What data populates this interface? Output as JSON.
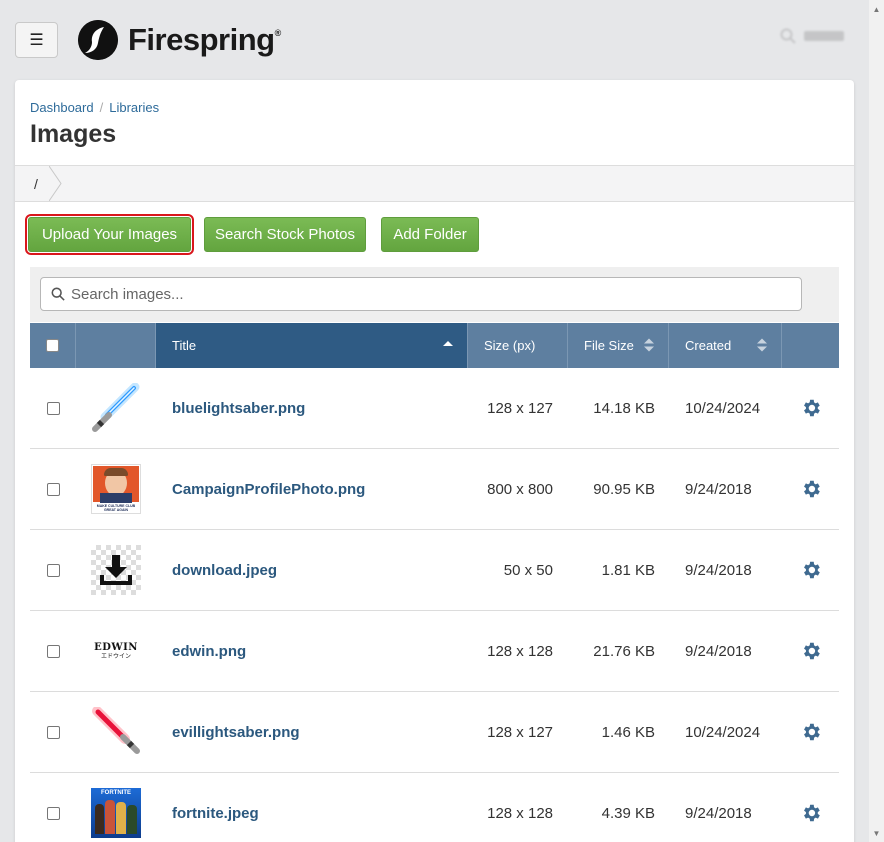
{
  "logo": {
    "name": "Firespring",
    "trademark": "®"
  },
  "breadcrumb": {
    "dashboard": "Dashboard",
    "separator": "/",
    "libraries": "Libraries"
  },
  "page": {
    "title": "Images"
  },
  "pathbar": {
    "root": "/"
  },
  "actions": {
    "upload": "Upload Your Images",
    "stock": "Search Stock Photos",
    "folder": "Add Folder"
  },
  "search": {
    "placeholder": "Search images..."
  },
  "table": {
    "headers": {
      "title": "Title",
      "size": "Size (px)",
      "file_size": "File Size",
      "created": "Created"
    },
    "rows": [
      {
        "title": "bluelightsaber.png",
        "size": "128 x 127",
        "file_size": "14.18 KB",
        "created": "10/24/2024",
        "thumb": "blue-lightsaber"
      },
      {
        "title": "CampaignProfilePhoto.png",
        "size": "800 x 800",
        "file_size": "90.95 KB",
        "created": "9/24/2018",
        "thumb": "campaign-photo"
      },
      {
        "title": "download.jpeg",
        "size": "50 x 50",
        "file_size": "1.81 KB",
        "created": "9/24/2018",
        "thumb": "download-icon"
      },
      {
        "title": "edwin.png",
        "size": "128 x 128",
        "file_size": "21.76 KB",
        "created": "9/24/2018",
        "thumb": "edwin-logo"
      },
      {
        "title": "evillightsaber.png",
        "size": "128 x 127",
        "file_size": "1.46 KB",
        "created": "10/24/2024",
        "thumb": "red-lightsaber"
      },
      {
        "title": "fortnite.jpeg",
        "size": "128 x 128",
        "file_size": "4.39 KB",
        "created": "9/24/2018",
        "thumb": "fortnite-art"
      }
    ],
    "thumb_text": {
      "campaign": "MAKE CULTURE CLUB GREAT AGAIN",
      "edwin": "EDWIN",
      "edwin_sub": "エドウイン",
      "fortnite": "FORTNITE"
    }
  },
  "colors": {
    "accent": "#6fb04a",
    "header": "#5e7fa0",
    "header_active": "#2f5b84",
    "link": "#2b587e",
    "highlight": "#d9161c"
  }
}
